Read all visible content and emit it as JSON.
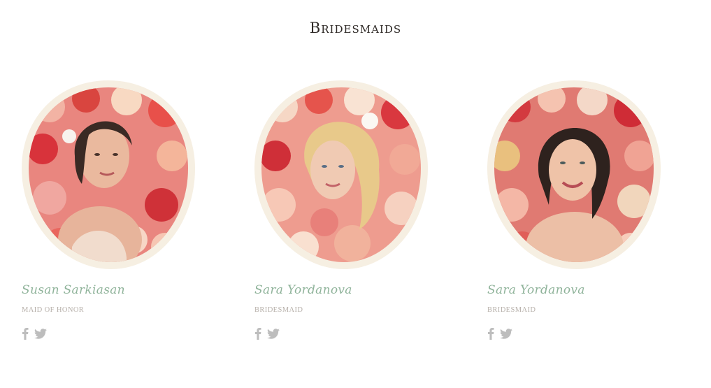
{
  "section": {
    "title": "Bridesmaids"
  },
  "members": [
    {
      "name": "Susan Sarkiasan",
      "role": "MAID OF HONOR",
      "social": [
        "facebook-icon",
        "twitter-icon"
      ]
    },
    {
      "name": "Sara Yordanova",
      "role": "BRIDESMAID",
      "social": [
        "facebook-icon",
        "twitter-icon"
      ]
    },
    {
      "name": "Sara Yordanova",
      "role": "BRIDESMAID",
      "social": [
        "facebook-icon",
        "twitter-icon"
      ]
    }
  ],
  "colors": {
    "frame": "#f6efe2",
    "name": "#8fb39a",
    "role": "#b7b0aa",
    "icon": "#bdbdbd",
    "title": "#2f2a27"
  }
}
